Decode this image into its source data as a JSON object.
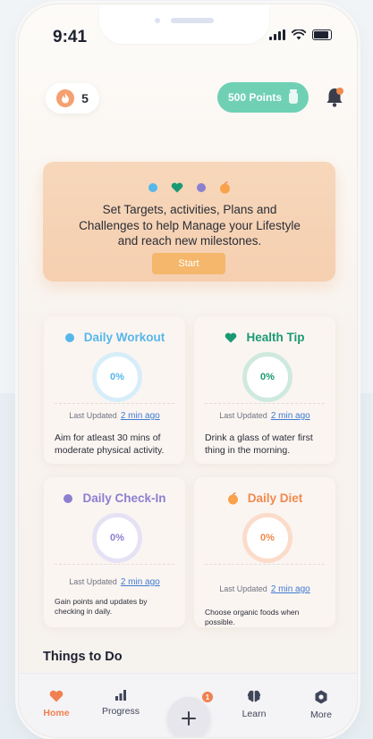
{
  "status_bar": {
    "time": "9:41"
  },
  "header": {
    "streak_count": "5",
    "points_label": "500 Points"
  },
  "banner": {
    "message": "Set Targets, activities, Plans and Challenges to help Manage your Lifestyle and reach new milestones.",
    "start_label": "Start"
  },
  "cards": [
    {
      "title": "Daily Workout",
      "percent": "0%",
      "updated_label": "Last Updated",
      "updated_link": "2 min ago",
      "description": "Aim for atleast 30 mins of moderate physical activity.",
      "color": "#56b7ea"
    },
    {
      "title": "Health Tip",
      "percent": "0%",
      "updated_label": "Last Updated",
      "updated_link": "2 min ago",
      "description": "Drink a glass of water first thing in the morning.",
      "color": "#1a9a73"
    },
    {
      "title": "Daily Check-In",
      "percent": "0%",
      "updated_label": "Last Updated",
      "updated_link": "2 min ago",
      "description": "Gain points and updates by checking in daily.",
      "color": "#8b7fd0"
    },
    {
      "title": "Daily Diet",
      "percent": "0%",
      "updated_label": "Last Updated",
      "updated_link": "2 min ago",
      "description": "Choose organic foods when possible.",
      "color": "#f08a4e"
    }
  ],
  "section": {
    "title": "Things to Do"
  },
  "tabbar": {
    "home": "Home",
    "progress": "Progress",
    "add_badge": "1",
    "learn": "Learn",
    "more": "More"
  },
  "colors": {
    "accent": "#f08050",
    "points_green": "#6fd0b4",
    "banner_bg": "#f7d7bb",
    "start_button": "#f4b76b"
  },
  "icons": [
    "fire-icon",
    "points-jar-icon",
    "bell-icon",
    "drop-icon",
    "heart-icon",
    "pill-icon",
    "apple-icon",
    "home-heart-icon",
    "progress-bars-icon",
    "plus-icon",
    "brain-icon",
    "gear-icon"
  ]
}
